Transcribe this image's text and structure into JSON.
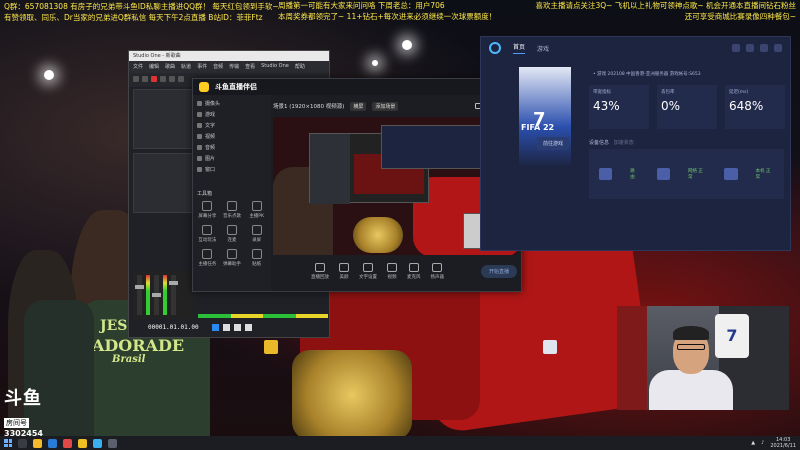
{
  "ticker": {
    "line1": "Q群：657081308 有房子的兄弟带斗鱼ID私聊主播进QQ群！ 每天红包领到手软~",
    "line2": "有赞领取、同乐、Dr当家的兄弟进Q群私信   每天下午2点直播   B站ID：菲菲Ftz",
    "mid1": "周播第一可能有大家来问问咯   下周老总：用户706",
    "mid2": "本周奖券都领完了~ 11+钻石+每次进来必须继续一次球票额度！",
    "right1": "喜欢主播请点关注3Q~ 飞机以上礼物可领神点歌~ 机会开通本直播间钻石粉丝",
    "right2": "还可享受商城比赛录像四种餐包~"
  },
  "logo": {
    "mark": "斗鱼",
    "sub": "房间号",
    "room_id": "3302454"
  },
  "editor": {
    "title": "Studio One - 新歌曲",
    "menu": [
      "文件",
      "编辑",
      "歌曲",
      "轨道",
      "事件",
      "音频",
      "传输",
      "查看",
      "Studio One",
      "帮助"
    ],
    "time": "00001.01.01.00"
  },
  "streamapp": {
    "brand": "斗鱼直播伴侣",
    "header_title": "场景1 (1920×1080 视频源)",
    "header_pill": "横屏",
    "scene_btn": "添加场景",
    "scenes": [
      "摄像头",
      "游戏",
      "文字",
      "视频",
      "音频",
      "图片",
      "窗口"
    ],
    "tools_label": "工具箱",
    "tools": [
      "屏幕分享",
      "音乐点歌",
      "主播PK",
      "互动玩法",
      "连麦",
      "录屏",
      "主播任务",
      "弹幕助手",
      "贴纸"
    ],
    "bottom_buttons": [
      "直播回放",
      "美颜",
      "文字设置",
      "视频",
      "麦克风",
      "扬声器"
    ],
    "go_live": "开始直播"
  },
  "dashboard": {
    "nav": [
      "首页",
      "游戏"
    ],
    "active_nav": "首页",
    "hero_number": "7",
    "game_title": "FIFA 22",
    "cta": "前往游戏",
    "info": "• 游戏  202108   中国香港-亚洲服务器   游戏帐号:S653",
    "stats": [
      {
        "label": "带宽指标",
        "value": "43%"
      },
      {
        "label": "丢包率",
        "value": "0%"
      },
      {
        "label": "延迟(ms)",
        "value": "648%"
      }
    ],
    "devices_head": "设备信息",
    "devices_sub": "加速状态",
    "device_labels": [
      "路由",
      "网络 正常",
      "本机 正常"
    ]
  },
  "webcam": {
    "jersey_number": "7"
  },
  "shirt": {
    "line1": "JESSE",
    "line2": "ADORADE",
    "line3": "Brasil"
  },
  "taskbar": {
    "time": "14:03",
    "date": "2021/6/11"
  }
}
